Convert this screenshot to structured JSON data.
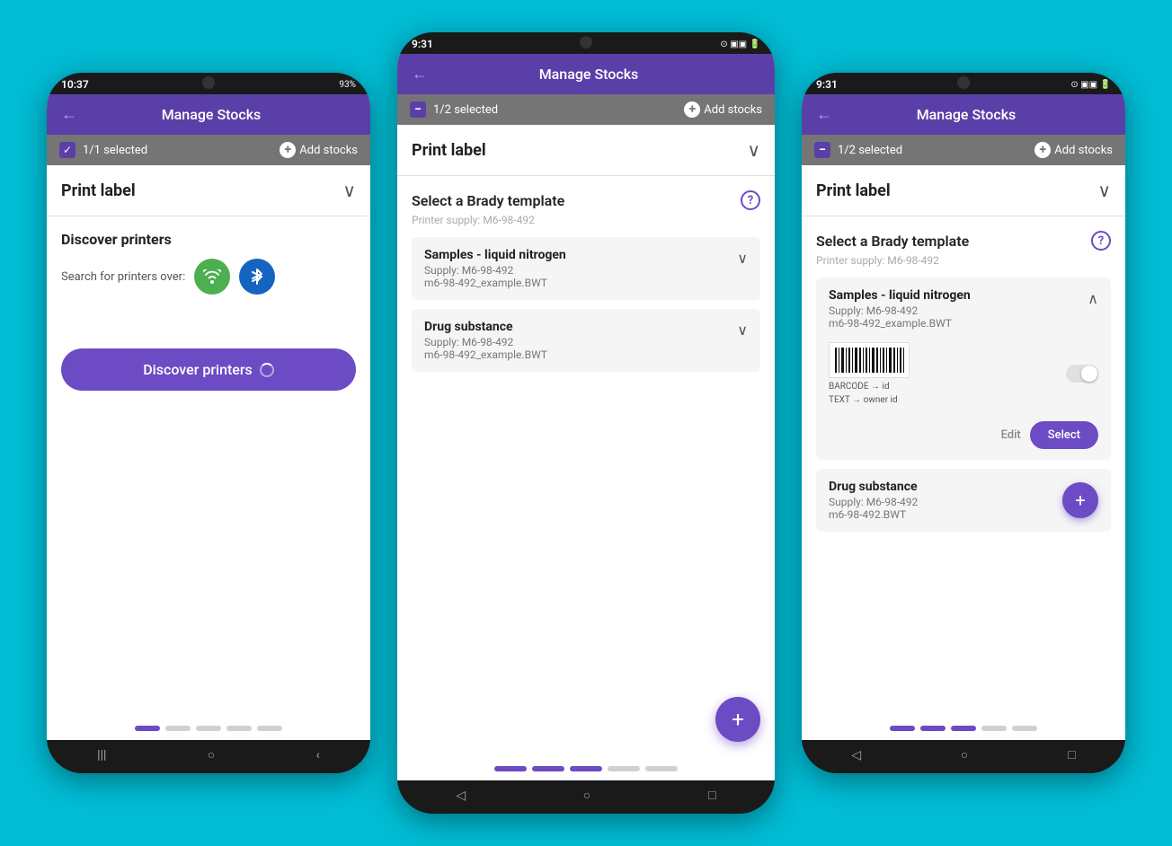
{
  "background_color": "#00BCD4",
  "phone_left": {
    "status_time": "10:37",
    "status_battery": "93%",
    "header": {
      "title": "Manage Stocks",
      "back_label": "←"
    },
    "selection_bar": {
      "selected_text": "1/1 selected",
      "add_stocks_label": "Add stocks"
    },
    "print_label": {
      "title": "Print label",
      "chevron": "∨"
    },
    "discover": {
      "title": "Discover printers",
      "search_over_label": "Search for printers over:"
    },
    "discover_button": "Discover printers",
    "progress_dots": [
      true,
      false,
      false,
      false,
      false
    ],
    "nav_icons": [
      "|||",
      "○",
      "‹"
    ]
  },
  "phone_center": {
    "status_time": "9:31",
    "header": {
      "title": "Manage Stocks",
      "back_label": "←"
    },
    "selection_bar": {
      "selected_text": "1/2 selected",
      "add_stocks_label": "Add stocks"
    },
    "print_label": {
      "title": "Print label",
      "chevron": "∨"
    },
    "template_section": {
      "title": "Select a Brady template",
      "printer_supply": "Printer supply: M6-98-492",
      "items": [
        {
          "name": "Samples - liquid nitrogen",
          "supply": "Supply: M6-98-492",
          "file": "m6-98-492_example.BWT",
          "expanded": false
        },
        {
          "name": "Drug substance",
          "supply": "Supply: M6-98-492",
          "file": "m6-98-492_example.BWT",
          "expanded": false
        }
      ]
    },
    "fab_label": "+",
    "progress_dots": [
      true,
      true,
      true,
      false,
      false
    ],
    "nav_icons": [
      "◁",
      "○",
      "□"
    ]
  },
  "phone_right": {
    "status_time": "9:31",
    "header": {
      "title": "Manage Stocks",
      "back_label": "←"
    },
    "selection_bar": {
      "selected_text": "1/2 selected",
      "add_stocks_label": "Add stocks"
    },
    "print_label": {
      "title": "Print label",
      "chevron": "∨"
    },
    "template_section": {
      "title": "Select a Brady template",
      "printer_supply": "Printer supply: M6-98-492",
      "item_expanded": {
        "name": "Samples - liquid nitrogen",
        "supply": "Supply: M6-98-492",
        "file": "m6-98-492_example.BWT",
        "barcode_label": "BARCODE → id",
        "text_label": "TEXT → owner id",
        "edit_label": "Edit",
        "select_label": "Select"
      },
      "item2": {
        "name": "Drug substance",
        "supply": "Supply: M6-98-492",
        "file": "m6-98-492.BWT"
      }
    },
    "fab_label": "+",
    "progress_dots": [
      true,
      true,
      true,
      false,
      false
    ],
    "nav_icons": [
      "◁",
      "○",
      "□"
    ]
  }
}
